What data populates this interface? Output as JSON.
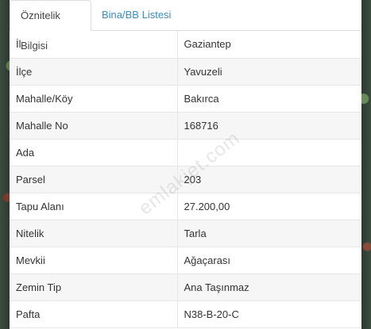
{
  "tabs": [
    {
      "label": "Öznitelik Bilgisi",
      "active": true
    },
    {
      "label": "Bina/BB Listesi",
      "active": false
    }
  ],
  "rows": [
    {
      "key": "İl",
      "value": "Gaziantep"
    },
    {
      "key": "İlçe",
      "value": "Yavuzeli"
    },
    {
      "key": "Mahalle/Köy",
      "value": "Bakırca"
    },
    {
      "key": "Mahalle No",
      "value": "168716"
    },
    {
      "key": "Ada",
      "value": ""
    },
    {
      "key": "Parsel",
      "value": "203"
    },
    {
      "key": "Tapu Alanı",
      "value": "27.200,00"
    },
    {
      "key": "Nitelik",
      "value": "Tarla"
    },
    {
      "key": "Mevkii",
      "value": "Ağaçarası"
    },
    {
      "key": "Zemin Tip",
      "value": "Ana Taşınmaz"
    },
    {
      "key": "Pafta",
      "value": "N38-B-20-C"
    }
  ],
  "watermark": "emlakjet.com"
}
